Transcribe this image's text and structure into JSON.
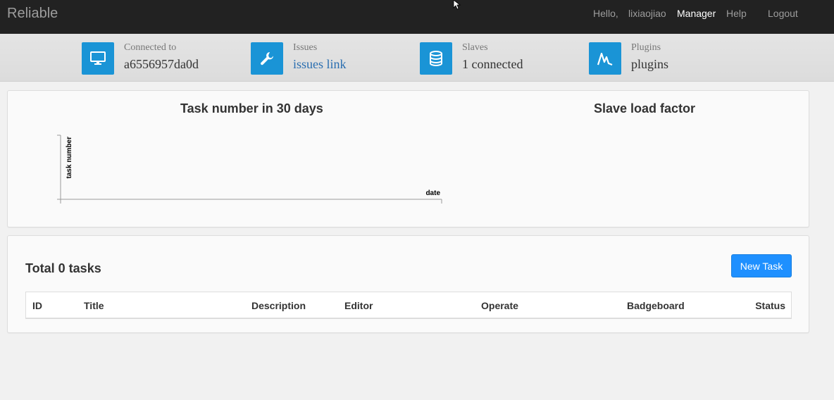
{
  "navbar": {
    "brand": "Reliable",
    "hello": "Hello,",
    "username": "lixiaojiao",
    "manager": "Manager",
    "help": "Help",
    "logout": "Logout"
  },
  "stats": [
    {
      "icon": "monitor-icon",
      "label": "Connected to",
      "value": "a6556957da0d"
    },
    {
      "icon": "wrench-icon",
      "label": "Issues",
      "value": "issues link"
    },
    {
      "icon": "database-icon",
      "label": "Slaves",
      "value": "1 connected"
    },
    {
      "icon": "chart-peak-icon",
      "label": "Plugins",
      "value": "plugins"
    }
  ],
  "charts": {
    "task_title": "Task number in 30 days",
    "slave_title": "Slave load factor"
  },
  "chart_data": [
    {
      "type": "line",
      "title": "Task number in 30 days",
      "xlabel": "date",
      "ylabel": "task number",
      "x": [],
      "series": []
    }
  ],
  "tasks": {
    "total": "Total 0 tasks",
    "new_task": "New Task",
    "columns": [
      "ID",
      "Title",
      "Description",
      "Editor",
      "Operate",
      "Badgeboard",
      "Status"
    ],
    "rows": []
  },
  "colors": {
    "navbar": "#222222",
    "stat_icon": "#1a94d6",
    "primary_button": "#1e90ff",
    "link": "#2a6eb0"
  }
}
